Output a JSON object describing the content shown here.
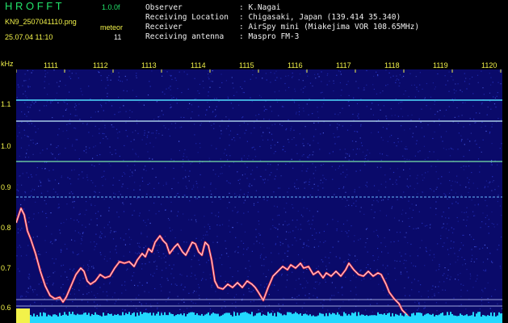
{
  "header": {
    "app_name": "H R O F F T",
    "version": "1.0.0f",
    "filename": "KN9_2507041110.png",
    "meteor_label": "meteor",
    "datetime": "25.07.04 11:10",
    "meteor_count": "11",
    "info": [
      {
        "label": "Observer",
        "value": ":  K.Nagai"
      },
      {
        "label": "Receiving Location",
        "value": ":  Chigasaki, Japan (139.414 35.340)"
      },
      {
        "label": "Receiver",
        "value": ":  AirSpy mini (Miakejima VOR 108.65MHz)"
      },
      {
        "label": "Receiving antenna",
        "value": ":  Maspro FM-3"
      }
    ]
  },
  "axis": {
    "y_unit": "kHz",
    "x_ticks": [
      "1111",
      "1112",
      "1113",
      "1114",
      "1115",
      "1116",
      "1117",
      "1118",
      "1119",
      "1120"
    ],
    "y_ticks": [
      "1.1",
      "1.0",
      "0.9",
      "0.8",
      "0.7",
      "0.6"
    ]
  },
  "colors": {
    "background": "#0a0a6a",
    "noise_blue": "#2a3ad0",
    "horizontal_lines": "#7ad8ff",
    "trace_red": "#ff3a3a",
    "trace_white": "#e8e8ff",
    "bottom_bar": "#22d8ff",
    "yellow_marker": "#f2f24a"
  }
}
